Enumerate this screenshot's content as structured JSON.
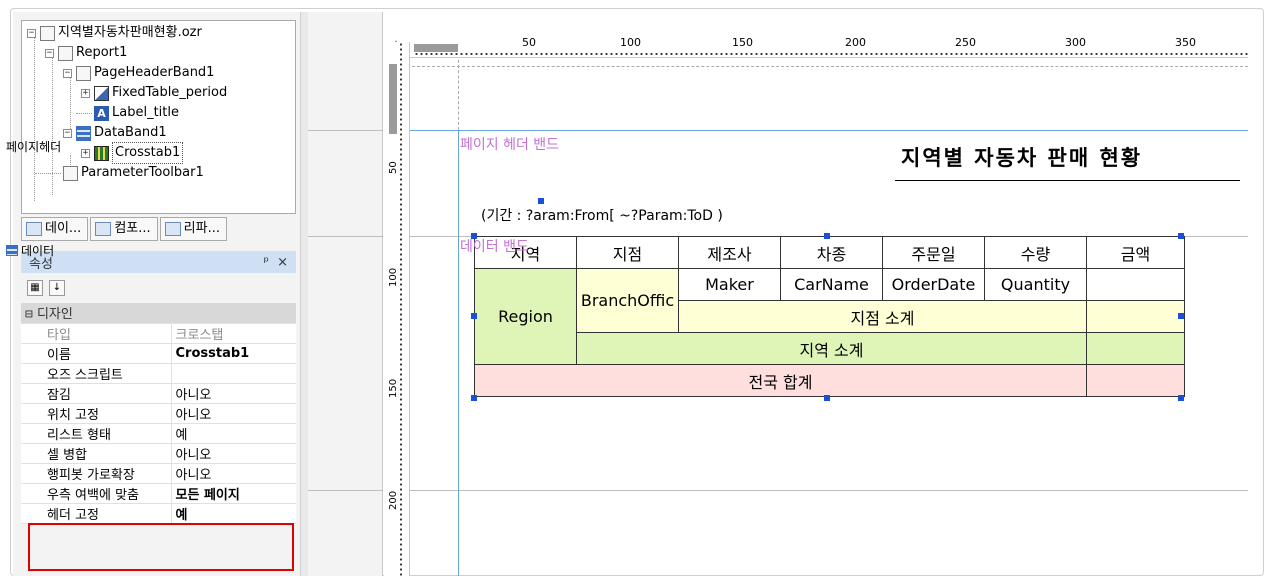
{
  "tree": {
    "items": [
      {
        "label": "지역별자동차판매현황.ozr",
        "toggle": "−",
        "icon": "report-file-icon"
      },
      {
        "label": "Report1",
        "toggle": "−",
        "icon": "report-icon"
      },
      {
        "label": "PageHeaderBand1",
        "toggle": "−",
        "icon": "page-header-band-icon"
      },
      {
        "label": "FixedTable_period",
        "toggle": "+",
        "icon": "fixed-table-icon"
      },
      {
        "label": "Label_title",
        "toggle": "",
        "icon": "label-icon"
      },
      {
        "label": "DataBand1",
        "toggle": "−",
        "icon": "data-band-icon"
      },
      {
        "label": "Crosstab1",
        "toggle": "+",
        "icon": "crosstab-icon"
      },
      {
        "label": "ParameterToolbar1",
        "toggle": "",
        "icon": "parameter-toolbar-icon"
      }
    ]
  },
  "tabs": [
    "데이...",
    "컴포...",
    "리파..."
  ],
  "properties": {
    "title": "속성",
    "pin": "ᵖ",
    "close": "×",
    "category": "디자인",
    "rows": [
      {
        "key": "타입",
        "value": "크로스탭",
        "disabled": true
      },
      {
        "key": "이름",
        "value": "Crosstab1",
        "bold": true
      },
      {
        "key": "오즈 스크립트",
        "value": ""
      },
      {
        "key": "잠김",
        "value": "아니오"
      },
      {
        "key": "위치 고정",
        "value": "아니오"
      },
      {
        "key": "리스트 형태",
        "value": "예"
      },
      {
        "key": "셀 병합",
        "value": "아니오"
      },
      {
        "key": "행피봇 가로확장",
        "value": "아니오"
      },
      {
        "key": "우측 여백에 맞춤",
        "value": "모든 페이지",
        "bold": true
      },
      {
        "key": "헤더 고정",
        "value": "예",
        "bold": true
      }
    ]
  },
  "bands": {
    "page_header_short": "페이지헤더",
    "data_short": "데이터"
  },
  "ruler": {
    "unit": "pt",
    "h_labels": [
      "50",
      "100",
      "150",
      "200",
      "250",
      "300",
      "350"
    ],
    "v_labels": [
      "50",
      "100",
      "150",
      "200"
    ]
  },
  "canvas": {
    "page_header_band_name": "페이지 헤더 밴드",
    "data_band_name": "데이터 밴드",
    "title": "지역별 자동차 판매 현황",
    "period": "(기간 : ?aram:From[ ~?Param:ToD )"
  },
  "crosstab": {
    "headers": [
      "지역",
      "지점",
      "제조사",
      "차종",
      "주문일",
      "수량",
      "금액"
    ],
    "region": "Region",
    "branch": "BranchOffic",
    "maker": "Maker",
    "carname": "CarName",
    "orderdate": "OrderDate",
    "quantity": "Quantity",
    "branch_subtotal": "지점 소계",
    "region_subtotal": "지역 소계",
    "grand_total": "전국 합계"
  }
}
